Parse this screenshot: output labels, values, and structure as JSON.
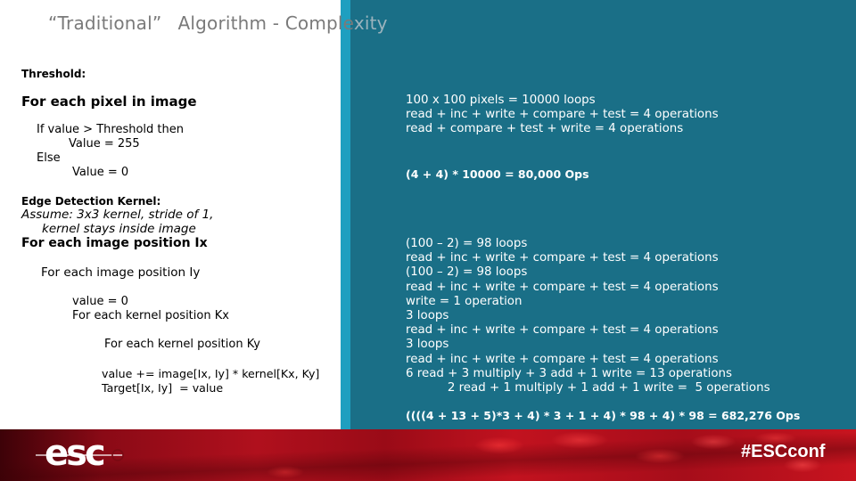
{
  "slide": {
    "title_part1": "“Traditional”",
    "title_part2": "Algorithm - Comple",
    "title_part3": "xity",
    "colors": {
      "panel": "#1a6f87",
      "panel_stripe": "#1e9fc0",
      "title_gray": "#7a7a7a",
      "footer_red": "#b0101d"
    }
  },
  "left": {
    "threshold_heading": "Threshold:",
    "for_each_pixel": "For each pixel in image",
    "if_line": "If value > Threshold then",
    "value_255": "Value = 255",
    "else_line": "Else",
    "value_0": "Value = 0",
    "edge_heading": "Edge Detection Kernel:",
    "assume_line1": "Assume: 3x3 kernel, stride of 1,",
    "assume_line2": "kernel stays inside image",
    "for_each_ix": "For each image position Ix",
    "for_each_iy": "For each image position Iy",
    "value_reset": "value = 0",
    "for_each_kx": "For each kernel position Kx",
    "for_each_ky": "For each kernel position Ky",
    "accumulate": "value += image[Ix, Iy] * kernel[Kx, Ky]",
    "target_assign": "Target[Ix, Iy]  = value"
  },
  "right": {
    "threshold_lines": [
      "100 x 100 pixels = 10000 loops",
      "read + inc + write + compare + test = 4 operations",
      "read + compare + test + write = 4 operations"
    ],
    "threshold_total": "(4 + 4) * 10000 = 80,000 Ops",
    "edge_lines": [
      "(100 – 2) = 98 loops",
      "read + inc + write + compare + test = 4 operations",
      "(100 – 2) = 98 loops",
      "read + inc + write + compare + test = 4 operations",
      "write = 1 operation",
      "3 loops",
      "read + inc + write + compare + test = 4 operations",
      "3 loops",
      "read + inc + write + compare + test = 4 operations",
      "6 read + 3 multiply + 3 add + 1 write = 13 operations",
      "           2 read + 1 multiply + 1 add + 1 write =  5 operations"
    ],
    "edge_total": "((((4 + 13 + 5)*3 + 4) * 3 + 1 + 4) * 98 + 4) * 98 = 682,276 Ops"
  },
  "footer": {
    "logo_text": "esc",
    "hashtag": "#ESCconf"
  }
}
